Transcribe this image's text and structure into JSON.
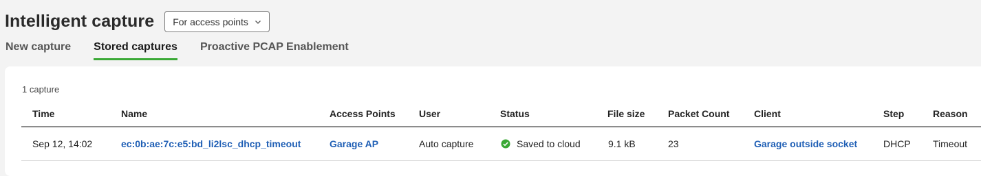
{
  "page": {
    "title": "Intelligent capture",
    "scope_dropdown": {
      "selected": "For access points",
      "icon": "chevron-down-icon"
    }
  },
  "tabs": [
    {
      "label": "New capture",
      "active": false
    },
    {
      "label": "Stored captures",
      "active": true
    },
    {
      "label": "Proactive PCAP Enablement",
      "active": false
    }
  ],
  "captures": {
    "count_text": "1 capture",
    "columns": [
      "Time",
      "Name",
      "Access Points",
      "User",
      "Status",
      "File size",
      "Packet Count",
      "Client",
      "Step",
      "Reason"
    ],
    "rows": [
      {
        "time": "Sep 12, 14:02",
        "name": "ec:0b:ae:7c:e5:bd_li2lsc_dhcp_timeout",
        "access_points": "Garage AP",
        "user": "Auto capture",
        "status": "Saved to cloud",
        "status_icon": "check-circle-icon",
        "file_size": "9.1 kB",
        "packet_count": "23",
        "client": "Garage outside socket",
        "step": "DHCP",
        "reason": "Timeout"
      }
    ]
  },
  "colors": {
    "accent_tab": "#3aa835",
    "link": "#1f5fb5",
    "status_ok": "#3aa835"
  }
}
